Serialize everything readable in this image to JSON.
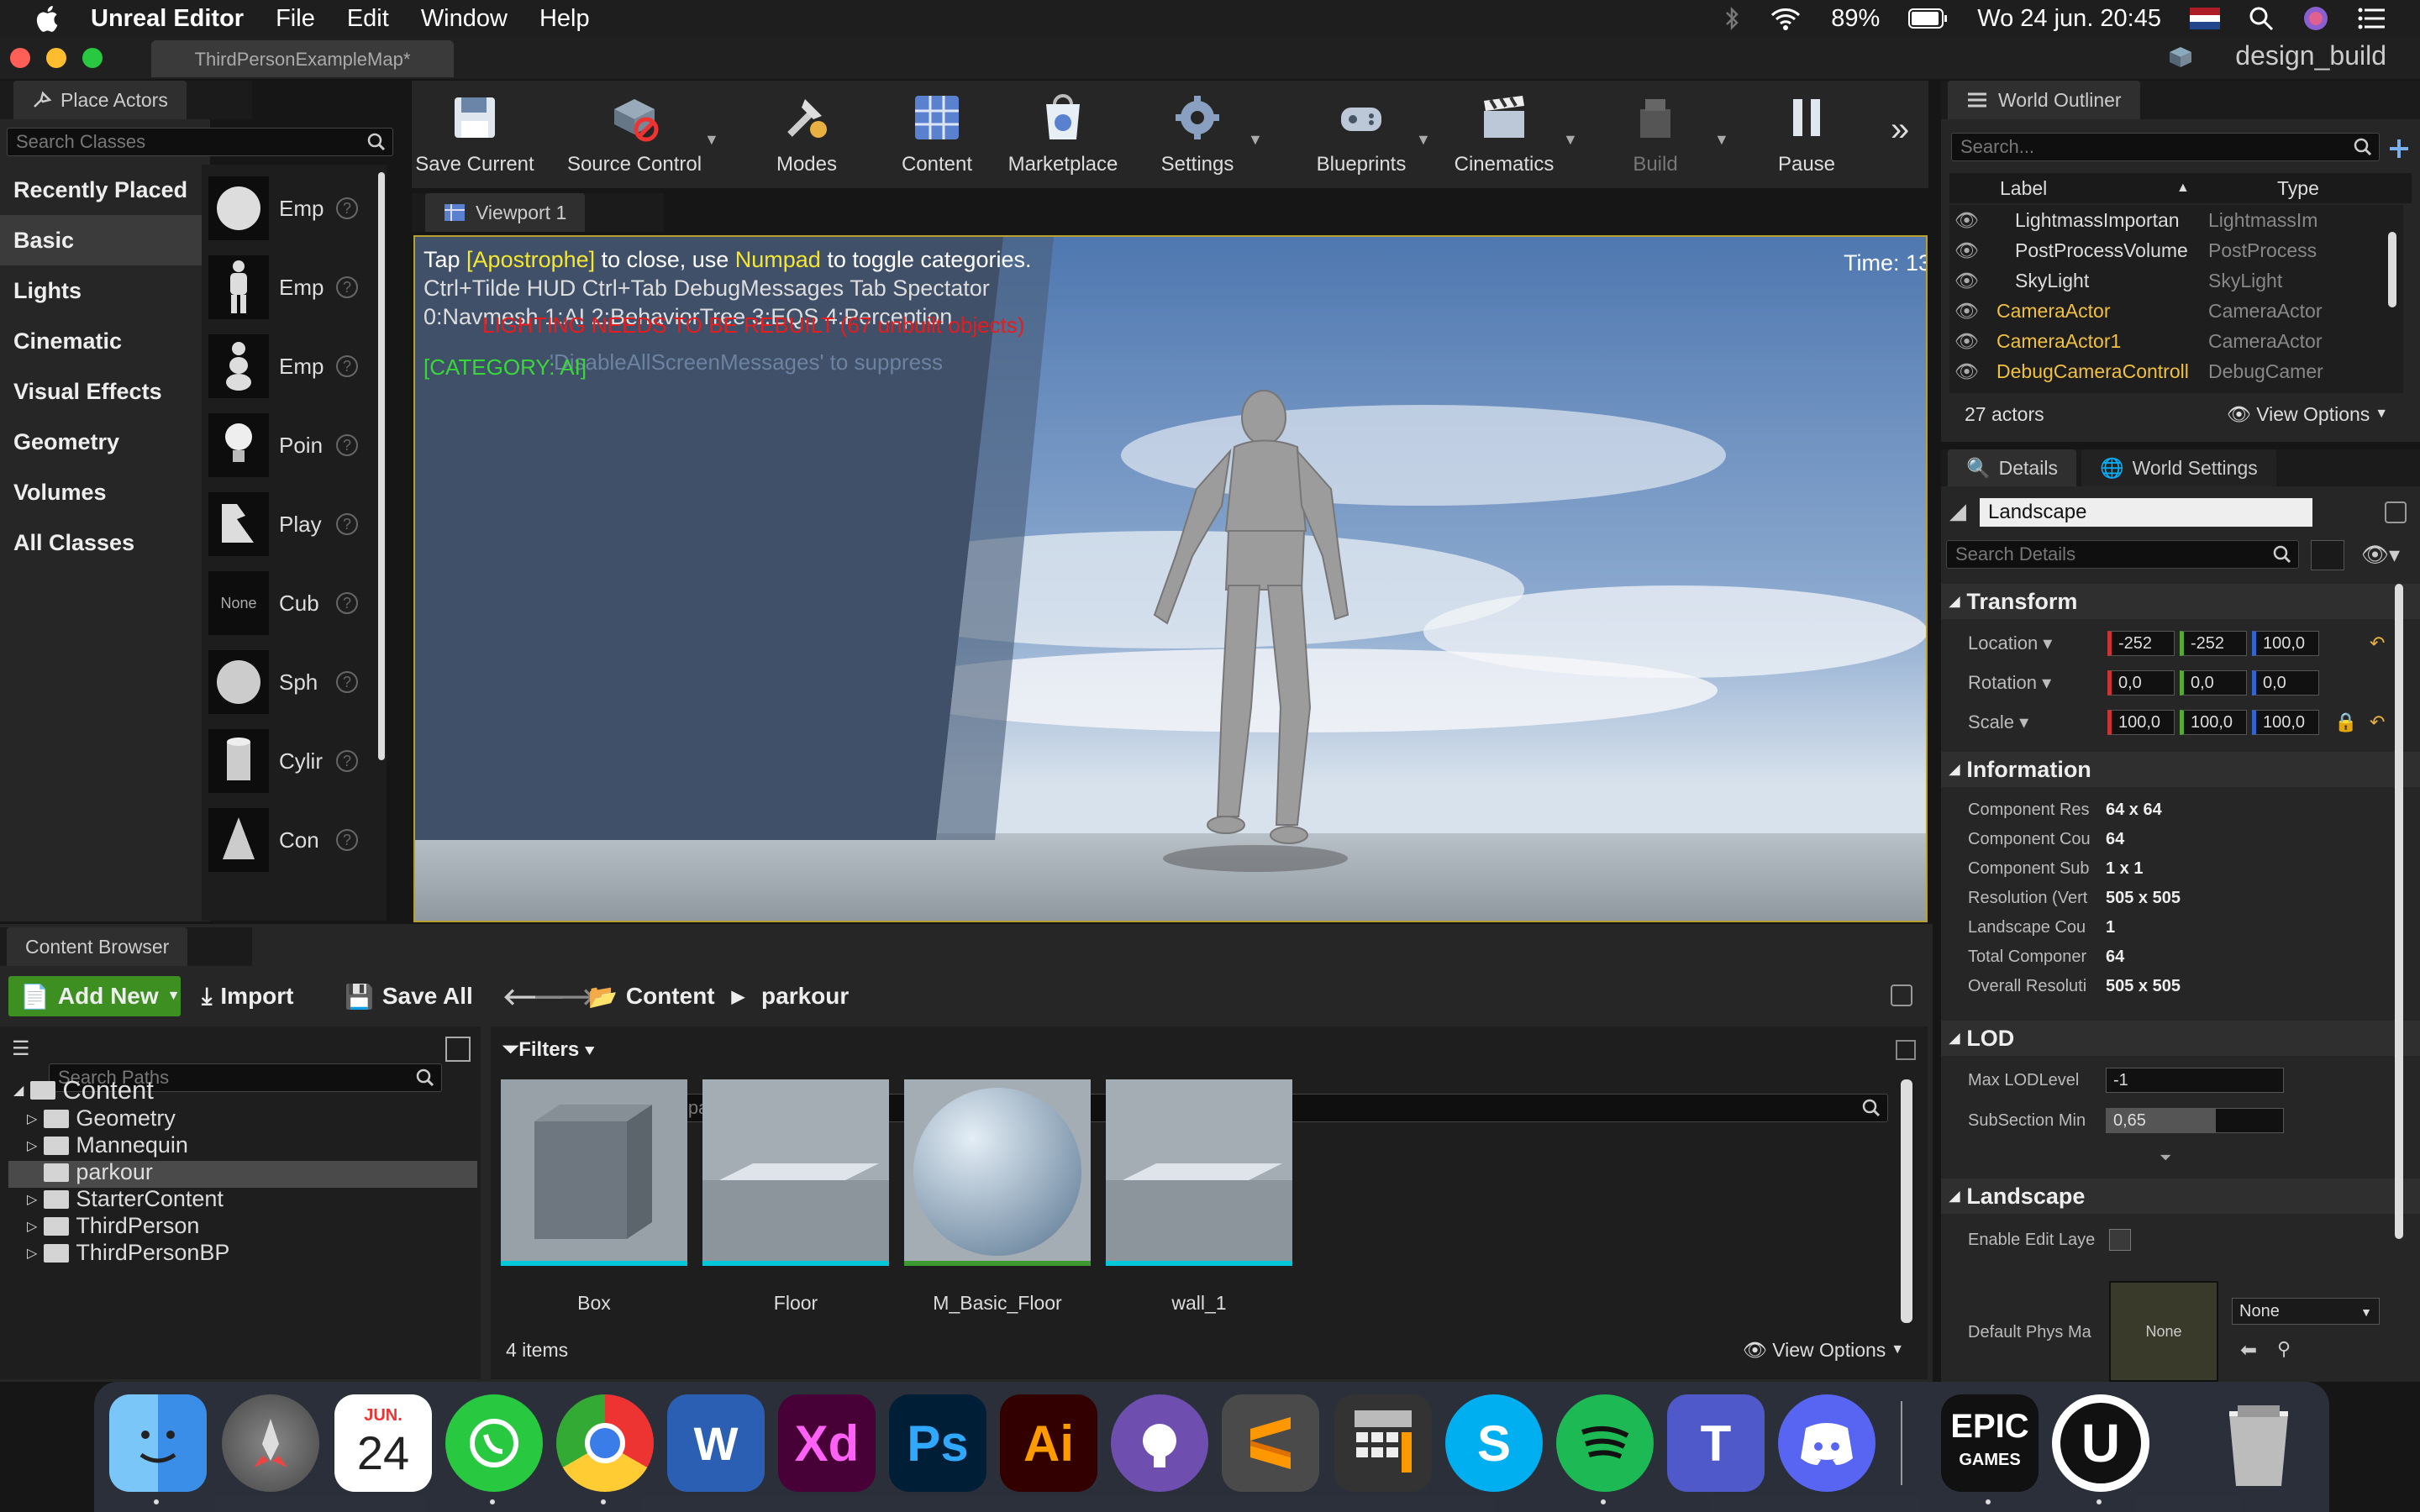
{
  "menubar": {
    "app": "Unreal Editor",
    "items": [
      "File",
      "Edit",
      "Window",
      "Help"
    ],
    "battery": "89%",
    "datetime": "Wo 24 jun.  20:45"
  },
  "window": {
    "doc_tab": "ThirdPersonExampleMap*",
    "project": "design_build"
  },
  "place_actors": {
    "title": "Place Actors",
    "search_placeholder": "Search Classes",
    "categories": [
      "Recently Placed",
      "Basic",
      "Lights",
      "Cinematic",
      "Visual Effects",
      "Geometry",
      "Volumes",
      "All Classes"
    ],
    "selected_category": "Basic",
    "actors": [
      "Emp",
      "Emp",
      "Emp",
      "Poin",
      "Play",
      "Cub",
      "Sph",
      "Cylir",
      "Con"
    ],
    "none_label": "None"
  },
  "toolbar": {
    "buttons": [
      "Save Current",
      "Source Control",
      "Modes",
      "Content",
      "Marketplace",
      "Settings",
      "Blueprints",
      "Cinematics",
      "Build",
      "Pause"
    ]
  },
  "viewport": {
    "tab": "Viewport 1",
    "line1_a": "Tap ",
    "line1_key": "[Apostrophe]",
    "line1_b": " to close, use ",
    "line1_key2": "Numpad",
    "line1_c": " to toggle categories.",
    "line2": "Ctrl+Tilde HUD  Ctrl+Tab DebugMessages  Tab Spectator",
    "line3": "0:Navmesh 1:AI  2:BehaviorTree  3:EQS  4:Perception",
    "warning": "LIGHTING NEEDS TO BE REBUILT (67 unbuilt objects)",
    "suppress": "'DisableAllScreenMessages' to suppress",
    "category": "[CATEGORY: AI]",
    "time": "Time: 13"
  },
  "outliner": {
    "title": "World Outliner",
    "search_placeholder": "Search...",
    "col_label": "Label",
    "col_type": "Type",
    "rows": [
      {
        "label": "LightmassImportan",
        "type": "LightmassIm",
        "color": "#dddddd"
      },
      {
        "label": "PostProcessVolume",
        "type": "PostProcess",
        "color": "#dddddd"
      },
      {
        "label": "SkyLight",
        "type": "SkyLight",
        "color": "#dddddd"
      },
      {
        "label": "CameraActor",
        "type": "CameraActor",
        "color": "#f0c040"
      },
      {
        "label": "CameraActor1",
        "type": "CameraActor",
        "color": "#f0c040"
      },
      {
        "label": "DebugCameraControll",
        "type": "DebugCamer",
        "color": "#f0c040"
      }
    ],
    "count": "27 actors",
    "view_options": "View Options"
  },
  "details": {
    "tab1": "Details",
    "tab2": "World Settings",
    "object_name": "Landscape",
    "search_placeholder": "Search Details",
    "transform": {
      "title": "Transform",
      "location": "Location",
      "rotation": "Rotation",
      "scale": "Scale",
      "loc_vals": [
        "-252",
        "-252",
        "100,0"
      ],
      "rot_vals": [
        "0,0",
        "0,0",
        "0,0"
      ],
      "scale_vals": [
        "100,0",
        "100,0",
        "100,0"
      ]
    },
    "information": {
      "title": "Information",
      "rows": [
        {
          "k": "Component Res",
          "v": "64 x 64"
        },
        {
          "k": "Component Cou",
          "v": "64"
        },
        {
          "k": "Component Sub",
          "v": "1 x 1"
        },
        {
          "k": "Resolution (Vert",
          "v": "505 x 505"
        },
        {
          "k": "Landscape Cou",
          "v": "1"
        },
        {
          "k": "Total Componer",
          "v": "64"
        },
        {
          "k": "Overall Resoluti",
          "v": "505 x 505"
        }
      ]
    },
    "lod": {
      "title": "LOD",
      "max_lod": "Max LODLevel",
      "max_lod_val": "-1",
      "subsection": "SubSection Min",
      "subsection_val": "0,65"
    },
    "landscape": {
      "title": "Landscape",
      "enable_edit": "Enable Edit Laye",
      "default_phys": "Default Phys Ma",
      "none_thumb": "None",
      "none_select": "None"
    }
  },
  "content_browser": {
    "title": "Content Browser",
    "add_new": "Add New",
    "import": "Import",
    "save_all": "Save All",
    "path_root": "Content",
    "path_folder": "parkour",
    "search_paths": "Search Paths",
    "filters": "Filters",
    "search_assets": "Search parkour",
    "tree_root": "Content",
    "folders": [
      "Geometry",
      "Mannequin",
      "parkour",
      "StarterContent",
      "ThirdPerson",
      "ThirdPersonBP"
    ],
    "selected_folder": "parkour",
    "assets": [
      "Box",
      "Floor",
      "M_Basic_Floor",
      "wall_1"
    ],
    "count": "4 items",
    "view_options": "View Options"
  },
  "dock": {
    "calendar_month": "JUN.",
    "calendar_day": "24",
    "apps": [
      "finder-icon",
      "launchpad-icon",
      "calendar-icon",
      "whatsapp-icon",
      "chrome-icon",
      "word-icon",
      "xd-icon",
      "photoshop-icon",
      "illustrator-icon",
      "github-icon",
      "sublime-icon",
      "calculator-icon",
      "skype-icon",
      "spotify-icon",
      "teams-icon",
      "discord-icon",
      "epic-games-icon",
      "unreal-icon",
      "trash-icon"
    ],
    "word_letter": "W",
    "xd_label": "Xd",
    "ps_label": "Ps",
    "ai_label": "Ai",
    "skype_letter": "S",
    "teams_letter": "T",
    "epic_line1": "EPIC",
    "epic_line2": "GAMES"
  },
  "colors": {
    "accent_green": "#3d8f22",
    "selection_outline": "#b8a030",
    "cyan_underline": "#00c8d8"
  }
}
